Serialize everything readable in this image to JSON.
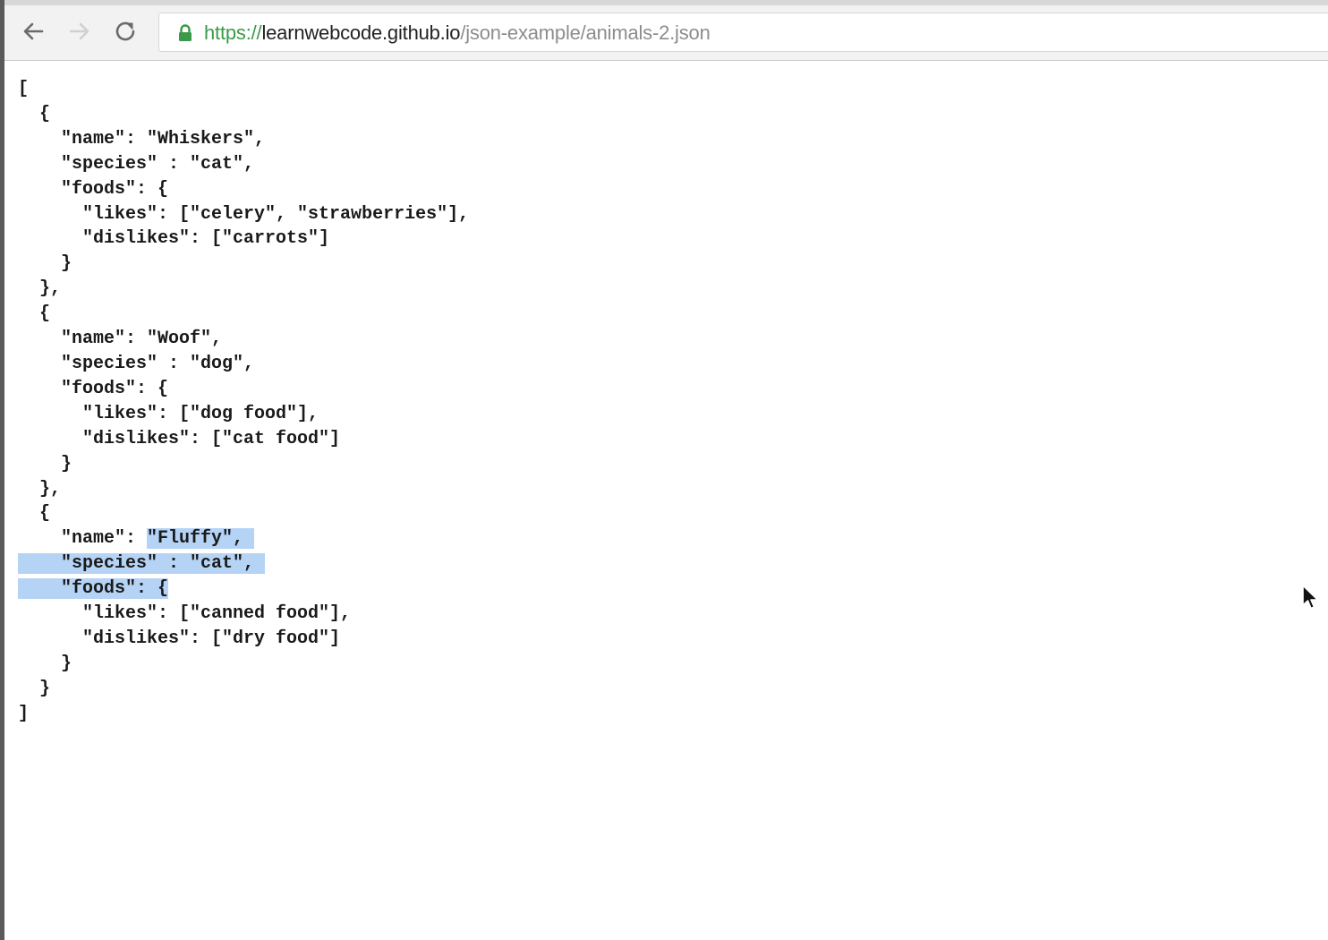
{
  "browser": {
    "url_scheme": "https://",
    "url_host": "learnwebcode.github.io",
    "url_path": "/json-example/animals-2.json",
    "icons": {
      "back": "arrow-left-icon",
      "forward": "arrow-right-icon",
      "reload": "reload-icon",
      "secure": "lock-icon",
      "pointer": "mouse-pointer-icon"
    },
    "colors": {
      "scheme": "#3a9a49",
      "selection": "#b5d3f5"
    }
  },
  "json_view": {
    "open_array": "[",
    "close_array": "]",
    "animals": [
      {
        "open": "  {",
        "name_line": "    \"name\": \"Whiskers\",",
        "species_line": "    \"species\" : \"cat\",",
        "foods_line": "    \"foods\": {",
        "likes_line": "      \"likes\": [\"celery\", \"strawberries\"],",
        "dislikes_line": "      \"dislikes\": [\"carrots\"]",
        "foods_close": "    }",
        "close": "  },"
      },
      {
        "open": "  {",
        "name_line": "    \"name\": \"Woof\",",
        "species_line": "    \"species\" : \"dog\",",
        "foods_line": "    \"foods\": {",
        "likes_line": "      \"likes\": [\"dog food\"],",
        "dislikes_line": "      \"dislikes\": [\"cat food\"]",
        "foods_close": "    }",
        "close": "  },"
      },
      {
        "open": "  {",
        "name_prefix": "    \"name\": ",
        "name_selected": "\"Fluffy\", ",
        "species_selected": "\"species\" : \"cat\", ",
        "foods_selected": "\"foods\": {",
        "likes_line": "      \"likes\": [\"canned food\"],",
        "dislikes_line": "      \"dislikes\": [\"dry food\"]",
        "foods_close": "    }",
        "close": "  }"
      }
    ]
  }
}
